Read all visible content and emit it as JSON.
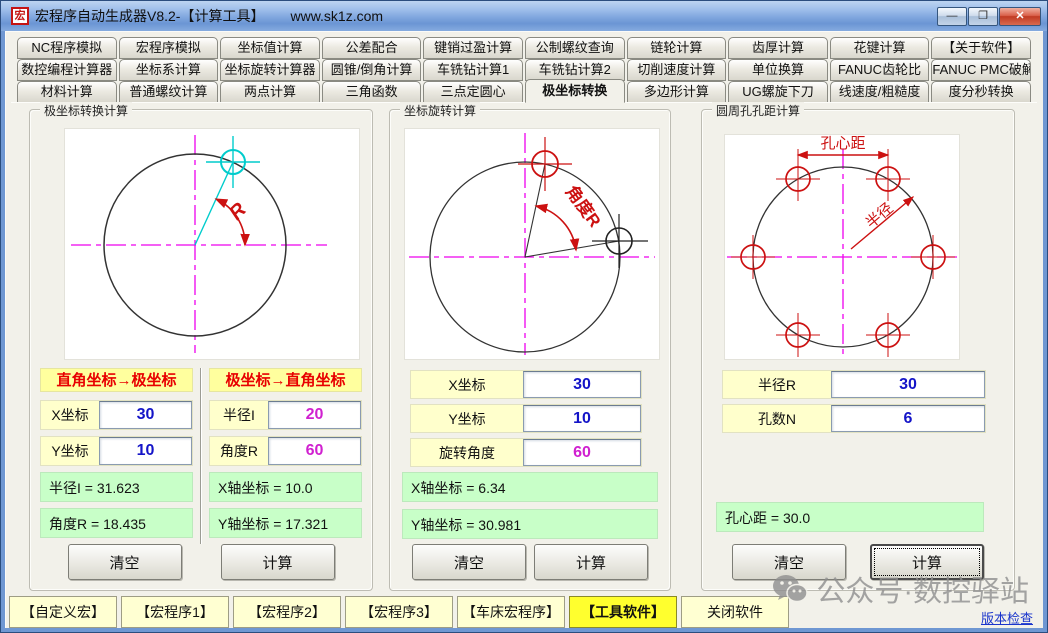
{
  "window": {
    "title": "宏程序自动生成器V8.2-【计算工具】",
    "url": "www.sk1z.com",
    "icon_label": "宏",
    "controls": {
      "minimize": "—",
      "maximize": "❐",
      "close": "✕"
    }
  },
  "tabs": {
    "row1": [
      "NC程序模拟",
      "宏程序模拟",
      "坐标值计算",
      "公差配合",
      "键销过盈计算",
      "公制螺纹查询",
      "链轮计算",
      "齿厚计算",
      "花键计算",
      "【关于软件】"
    ],
    "row2": [
      "数控编程计算器",
      "坐标系计算",
      "坐标旋转计算器",
      "圆锥/倒角计算",
      "车铣钻计算1",
      "车铣钻计算2",
      "切削速度计算",
      "单位换算",
      "FANUC齿轮比",
      "FANUC PMC破解"
    ],
    "row3": [
      "材料计算",
      "普通螺纹计算",
      "两点计算",
      "三角函数",
      "三点定圆心",
      "极坐标转换",
      "多边形计算",
      "UG螺旋下刀",
      "线速度/粗糙度",
      "度分秒转换"
    ],
    "selected": "极坐标转换"
  },
  "polar_panel": {
    "title": "极坐标转换计算",
    "diagram": {
      "r_label": "R"
    },
    "left_col": {
      "header": "直角坐标→极坐标",
      "inputs": [
        {
          "label": "X坐标",
          "value": "30"
        },
        {
          "label": "Y坐标",
          "value": "10"
        }
      ],
      "results": [
        "半径I = 31.623",
        "角度R = 18.435"
      ]
    },
    "right_col": {
      "header": "极坐标→直角坐标",
      "inputs": [
        {
          "label": "半径I",
          "value": "20"
        },
        {
          "label": "角度R",
          "value": "60"
        }
      ],
      "results": [
        "X轴坐标 = 10.0",
        "Y轴坐标 = 17.321"
      ]
    },
    "clear_button": "清空",
    "calc_button": "计算"
  },
  "rotate_panel": {
    "title": "坐标旋转计算",
    "diagram": {
      "angle_label": "角度R"
    },
    "inputs": [
      {
        "label": "X坐标",
        "value": "30"
      },
      {
        "label": "Y坐标",
        "value": "10"
      },
      {
        "label": "旋转角度",
        "value": "60"
      }
    ],
    "results": [
      "X轴坐标 = 6.34",
      "Y轴坐标 = 30.981"
    ],
    "clear_button": "清空",
    "calc_button": "计算"
  },
  "holes_panel": {
    "title": "圆周孔孔距计算",
    "diagram": {
      "pitch_label": "孔心距",
      "radius_label": "半径"
    },
    "inputs": [
      {
        "label": "半径R",
        "value": "30"
      },
      {
        "label": "孔数N",
        "value": "6"
      }
    ],
    "results": [
      "孔心距 = 30.0"
    ],
    "clear_button": "清空",
    "calc_button": "计算"
  },
  "bottom_bar": {
    "buttons": [
      "【自定义宏】",
      "【宏程序1】",
      "【宏程序2】",
      "【宏程序3】",
      "【车床宏程序】",
      "【工具软件】",
      "关闭软件"
    ],
    "active": "【工具软件】"
  },
  "footer": {
    "watermark": "公众号·数控驿站",
    "version_link": "版本检查"
  },
  "colors": {
    "value_blue": "#1414c8",
    "value_magenta": "#d020d0",
    "result_green_bg": "#c8ffc8",
    "label_yellow_bg": "#ffffcc",
    "header_yellow_bg": "#ffff9e",
    "header_red_text": "#e80000",
    "active_bottom_yellow": "#ffff2e",
    "bottom_btn_yellow": "#ffffd2",
    "diagram_magenta": "#ee00ee",
    "diagram_red": "#cc1111",
    "diagram_cyan": "#00cccc",
    "link_blue": "#1a35cc"
  }
}
